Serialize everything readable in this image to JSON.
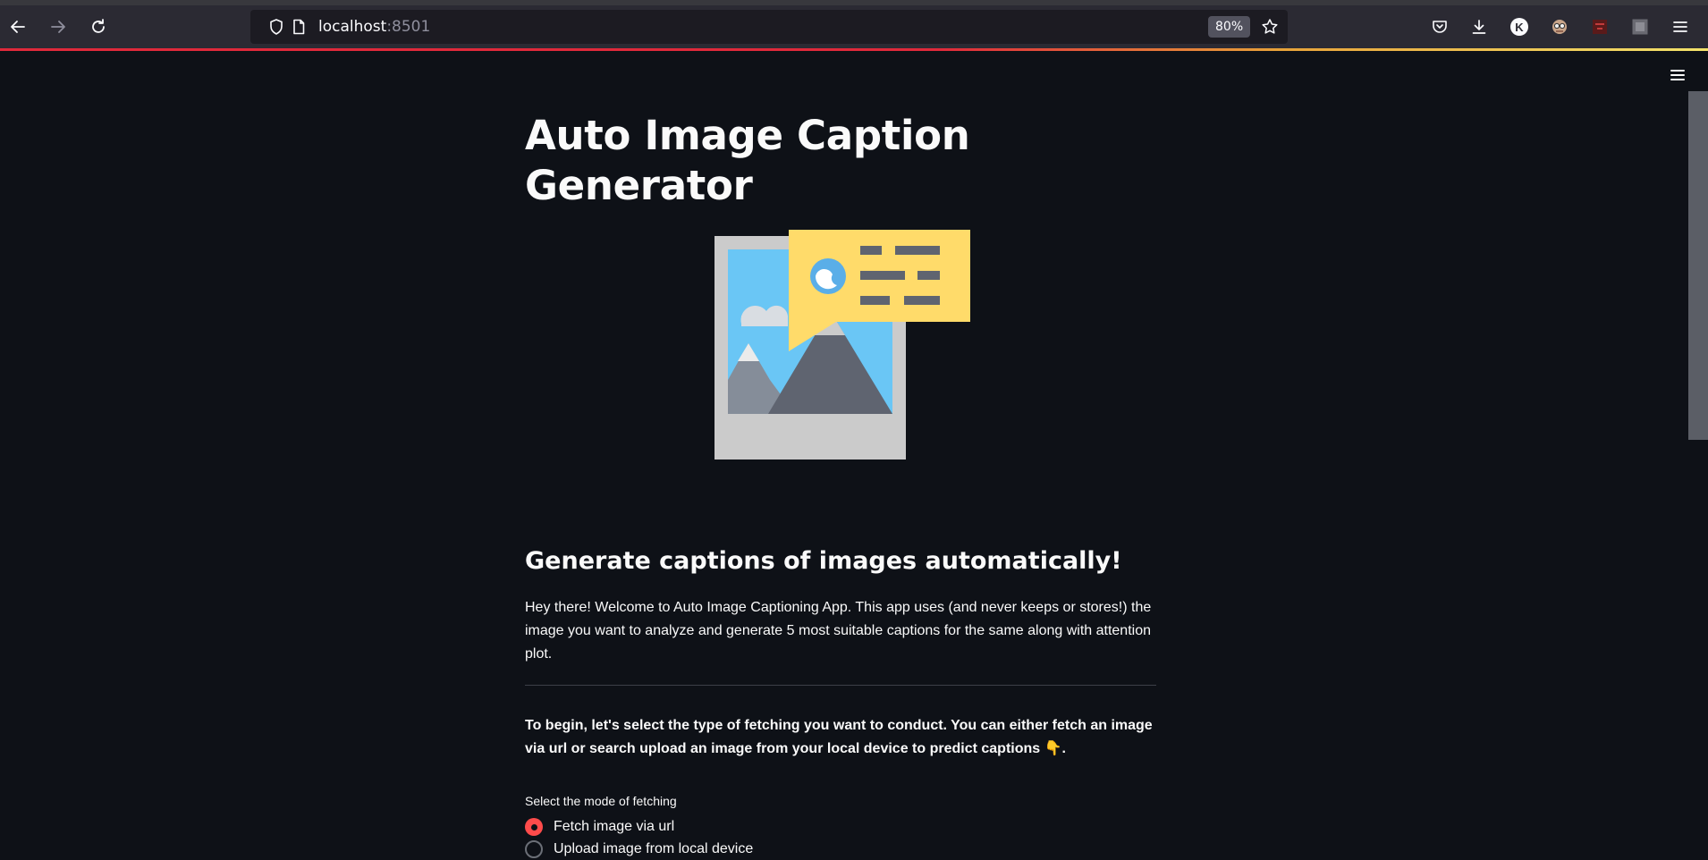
{
  "browser": {
    "url_host": "localhost",
    "url_port": ":8501",
    "zoom": "80%"
  },
  "page": {
    "title": "Auto Image Caption Generator",
    "subtitle": "Generate captions of images automatically!",
    "intro": "Hey there! Welcome to Auto Image Captioning App. This app uses (and never keeps or stores!) the image you want to analyze and generate 5 most suitable captions for the same along with attention plot.",
    "instructions": "To begin, let's select the type of fetching you want to conduct. You can either fetch an image via url or search upload an image from your local device to predict captions 👇.",
    "fetch_mode": {
      "label": "Select the mode of fetching",
      "options": [
        "Fetch image via url",
        "Upload image from local device"
      ],
      "selected": "Fetch image via url"
    }
  },
  "colors": {
    "background": "#0e1117",
    "accent": "#ff4b4b",
    "browser_toolbar": "#2b2a33"
  },
  "icons": [
    "back-arrow-icon",
    "forward-arrow-icon",
    "reload-icon",
    "shield-icon",
    "page-icon",
    "star-icon",
    "pocket-icon",
    "download-icon",
    "account-avatar-icon",
    "extension-glasses-icon",
    "extension-cors-icon",
    "extension-square-icon",
    "browser-menu-icon",
    "page-menu-icon"
  ]
}
